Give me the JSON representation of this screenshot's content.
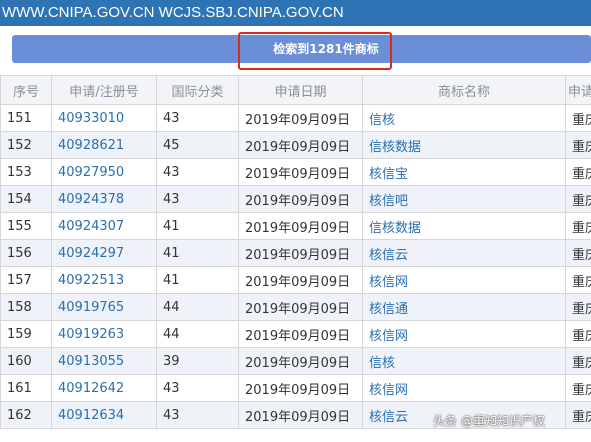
{
  "urlbar": {
    "text": "WWW.CNIPA.GOV.CN WCJS.SBJ.CNIPA.GOV.CN"
  },
  "banner": {
    "text": "检索到1281件商标"
  },
  "table": {
    "headers": [
      "序号",
      "申请/注册号",
      "国际分类",
      "申请日期",
      "商标名称",
      "申请人"
    ],
    "rows": [
      [
        "151",
        "40933010",
        "43",
        "2019年09月09日",
        "信核",
        "重庆"
      ],
      [
        "152",
        "40928621",
        "45",
        "2019年09月09日",
        "信核数据",
        "重庆"
      ],
      [
        "153",
        "40927950",
        "43",
        "2019年09月09日",
        "核信宝",
        "重庆"
      ],
      [
        "154",
        "40924378",
        "43",
        "2019年09月09日",
        "核信吧",
        "重庆"
      ],
      [
        "155",
        "40924307",
        "41",
        "2019年09月09日",
        "信核数据",
        "重庆"
      ],
      [
        "156",
        "40924297",
        "41",
        "2019年09月09日",
        "核信云",
        "重庆"
      ],
      [
        "157",
        "40922513",
        "41",
        "2019年09月09日",
        "核信网",
        "重庆"
      ],
      [
        "158",
        "40919765",
        "44",
        "2019年09月09日",
        "核信通",
        "重庆"
      ],
      [
        "159",
        "40919263",
        "44",
        "2019年09月09日",
        "核信网",
        "重庆"
      ],
      [
        "160",
        "40913055",
        "39",
        "2019年09月09日",
        "信核",
        "重庆"
      ],
      [
        "161",
        "40912642",
        "43",
        "2019年09月09日",
        "核信网",
        "重庆"
      ],
      [
        "162",
        "40912634",
        "43",
        "2019年09月09日",
        "核信云",
        "重庆"
      ]
    ]
  },
  "overlay": {
    "source": "头条 @重知知识产权"
  },
  "colors": {
    "urlbar": "#2e74b5",
    "banner": "#6b8fd6",
    "highlight_border": "#d9281f",
    "link": "#2a6fb0",
    "row_alt": "#eff3f9"
  }
}
